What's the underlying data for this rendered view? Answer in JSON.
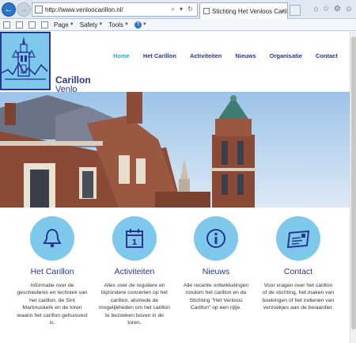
{
  "browser": {
    "url": "http://www.venloocarillon.nl/",
    "tab_title": "Stichting Het Venloos Caril...",
    "tab_close": "×",
    "addr_icons": "⌕ ▾ ↻",
    "toolbar": {
      "page": "Page",
      "safety": "Safety",
      "tools": "Tools",
      "help": "?"
    },
    "icons": [
      "home-icon",
      "star-icon",
      "gear-icon",
      "smiley-icon"
    ]
  },
  "site": {
    "name": "Carillon",
    "subname": "Venlo",
    "nav": [
      {
        "label": "Home",
        "active": true
      },
      {
        "label": "Het Carillon",
        "active": false
      },
      {
        "label": "Activiteiten",
        "active": false
      },
      {
        "label": "Nieuws",
        "active": false
      },
      {
        "label": "Organisatie",
        "active": false
      },
      {
        "label": "Contact",
        "active": false
      }
    ]
  },
  "features": [
    {
      "icon": "bell-icon",
      "title": "Het Carillon",
      "text": "Informatie over de geschiedenis en techniek van het carillon, de Sint Martinuskerk en de toren waarin het carillon gehuisvest is."
    },
    {
      "icon": "calendar-icon",
      "title": "Activiteiten",
      "text": "Alles over de reguliere en bijzondere concerten op het carillon, alsmede de mogelijkheden om het carillon te bezoeken boven in de toren."
    },
    {
      "icon": "info-icon",
      "title": "Nieuws",
      "text": "Alle recente ontwikkelingen rondom het carillon en de Stichting \"Het Venloos Carillon\" op een rijtje."
    },
    {
      "icon": "mail-icon",
      "title": "Contact",
      "text": "Voor vragen over het carillon of de stichting, het maken van boekingen of het indienen van verzoekjes aan de beiaardier."
    }
  ],
  "colors": {
    "brand_dark": "#283593",
    "brand_light": "#7ec8ec",
    "nav_active": "#3aa3d8"
  }
}
